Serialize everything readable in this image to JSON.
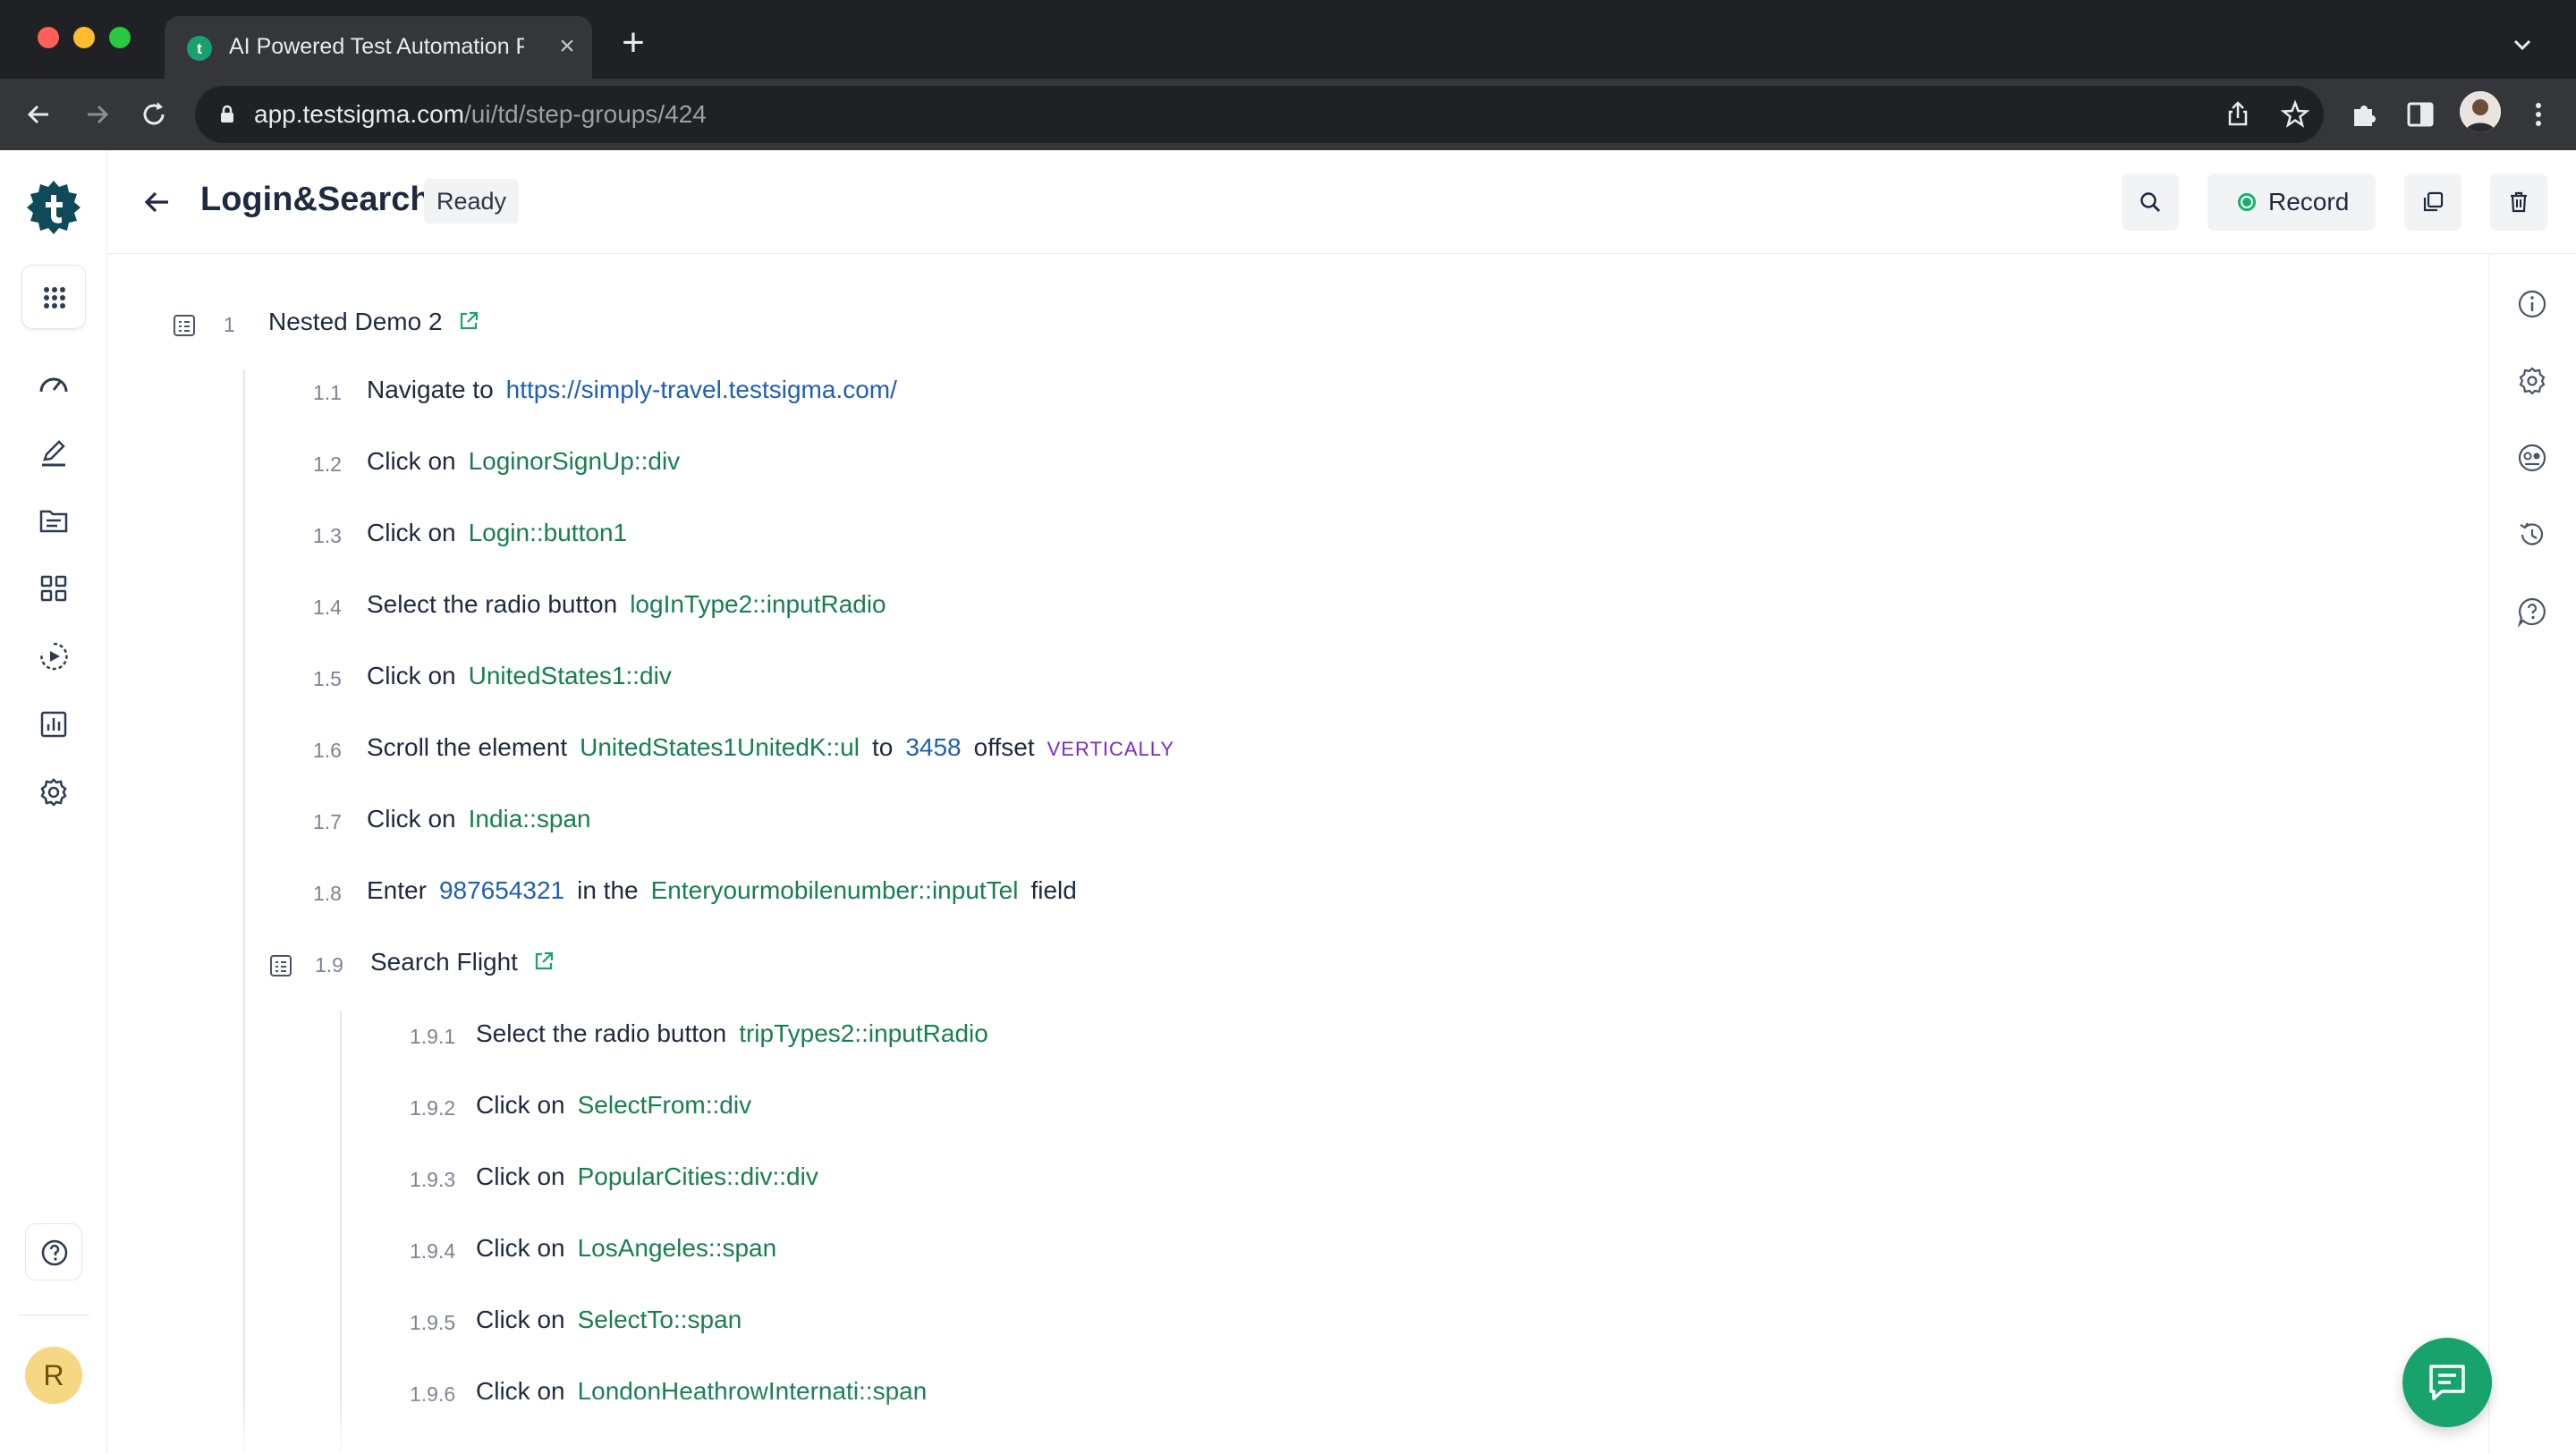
{
  "browser": {
    "tab_title": "AI Powered Test Automation P",
    "url_host": "app.testsigma.com",
    "url_path": "/ui/td/step-groups/424"
  },
  "header": {
    "title": "Login&Search",
    "status": "Ready",
    "record_label": "Record"
  },
  "user": {
    "avatar_initial": "R"
  },
  "group": {
    "number": "1",
    "title": "Nested Demo 2"
  },
  "steps": [
    {
      "num": "1.1",
      "parts": [
        "Navigate to",
        "https://simply-travel.testsigma.com/"
      ]
    },
    {
      "num": "1.2",
      "parts": [
        "Click on",
        "LoginorSignUp::div"
      ]
    },
    {
      "num": "1.3",
      "parts": [
        "Click on",
        "Login::button1"
      ]
    },
    {
      "num": "1.4",
      "parts": [
        "Select the radio button",
        "logInType2::inputRadio"
      ]
    },
    {
      "num": "1.5",
      "parts": [
        "Click on",
        "UnitedStates1::div"
      ]
    },
    {
      "num": "1.6",
      "parts": [
        "Scroll the element",
        "UnitedStates1UnitedK::ul",
        "to",
        "3458",
        "offset",
        "VERTICALLY"
      ]
    },
    {
      "num": "1.7",
      "parts": [
        "Click on",
        "India::span"
      ]
    },
    {
      "num": "1.8",
      "parts": [
        "Enter",
        "987654321",
        "in the",
        "Enteryourmobilenumber::inputTel",
        "field"
      ]
    }
  ],
  "subgroup": {
    "number": "1.9",
    "title": "Search Flight"
  },
  "substeps": [
    {
      "num": "1.9.1",
      "parts": [
        "Select the radio button",
        "tripTypes2::inputRadio"
      ]
    },
    {
      "num": "1.9.2",
      "parts": [
        "Click on",
        "SelectFrom::div"
      ]
    },
    {
      "num": "1.9.3",
      "parts": [
        "Click on",
        "PopularCities::div::div"
      ]
    },
    {
      "num": "1.9.4",
      "parts": [
        "Click on",
        "LosAngeles::span"
      ]
    },
    {
      "num": "1.9.5",
      "parts": [
        "Click on",
        "SelectTo::span"
      ]
    },
    {
      "num": "1.9.6",
      "parts": [
        "Click on",
        "LondonHeathrowInternati::span"
      ]
    }
  ],
  "colors": {
    "element": "#17804e",
    "value": "#1f5fb4",
    "direction": "#7a2bd0",
    "brand": "#0f4a5a"
  }
}
